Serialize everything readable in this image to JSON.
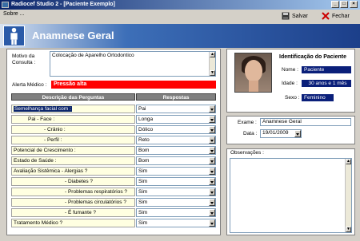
{
  "window": {
    "title": "Radiocef Studio 2 - [Paciente Exemplo]"
  },
  "menu": {
    "items": [
      {
        "label": "Sobre ..."
      }
    ]
  },
  "toolbar": {
    "save_label": "Salvar",
    "close_label": "Fechar"
  },
  "banner": {
    "title": "Anamnese Geral"
  },
  "form": {
    "motivo_label": "Motivo da Consulta :",
    "motivo_value": "Colocação de Aparelho Ortodontico",
    "alerta_label": "Alerta Médico :",
    "alerta_value": "Pressão alta"
  },
  "table": {
    "headers": [
      "Descrição das Perguntas",
      "Respostas"
    ],
    "rows": [
      {
        "question": "Semelhança facial com :",
        "answer": "Pai"
      },
      {
        "question": "Pai - Face :",
        "answer": "Longa"
      },
      {
        "question": "- Crânio :",
        "answer": "Dólico"
      },
      {
        "question": "- Perfil :",
        "answer": "Reto"
      },
      {
        "question": "Potencial de Crescimento :",
        "answer": "Bom"
      },
      {
        "question": "Estado de Saúde :",
        "answer": "Bom"
      },
      {
        "question": "Avaliação Sistêmica - Alergias ?",
        "answer": "Sim"
      },
      {
        "question": "- Diabetes ?",
        "answer": "Sim"
      },
      {
        "question": "- Problemas respiratórios ?",
        "answer": "Sim"
      },
      {
        "question": "- Problemas circulatórios ?",
        "answer": "Sim"
      },
      {
        "question": "- É fumante ?",
        "answer": "Sim"
      },
      {
        "question": "Tratamento Médico ?",
        "answer": "Sim"
      }
    ]
  },
  "patient": {
    "heading": "Identificação do Paciente",
    "name_label": "Nome :",
    "name_value": "Paciente",
    "age_label": "Idade :",
    "age_value": "30 anos e 1 mês",
    "sex_label": "Sexo :",
    "sex_value": "Feminino"
  },
  "exam": {
    "exam_label": "Exame :",
    "exam_value": "Anamnese Geral",
    "date_label": "Data :",
    "date_value": "19/01/2009"
  },
  "notes": {
    "label": "Observações :"
  }
}
